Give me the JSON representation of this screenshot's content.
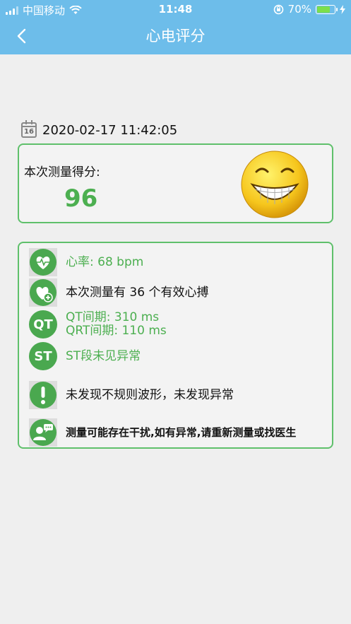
{
  "status_bar": {
    "carrier": "中国移动",
    "time": "11:48",
    "battery": "70%"
  },
  "nav": {
    "title": "心电评分"
  },
  "record": {
    "datetime": "2020-02-17 11:42:05",
    "calendar_day": "16"
  },
  "score": {
    "label": "本次测量得分:",
    "value": "96"
  },
  "details": {
    "heart_rate": "心率: 68 bpm",
    "beats": "本次测量有 36 个有效心搏",
    "qt_icon": "QT",
    "qt": "QT间期: 310 ms",
    "qrt": "QRT间期: 110 ms",
    "st_icon": "ST",
    "st": "ST段未见异常",
    "waveform": "未发现不规则波形，未发现异常",
    "advice": "测量可能存在干扰,如有异常,请重新测量或找医生"
  },
  "icons": {
    "back": "back-arrow-icon",
    "calendar": "calendar-icon",
    "smiley": "smiley-face-icon",
    "heart": "heart-rate-icon",
    "heart_plus": "heart-plus-icon",
    "alert": "exclamation-icon",
    "doctor": "doctor-chat-icon"
  },
  "colors": {
    "header": "#6dbdea",
    "accent_green": "#4caf50",
    "card_border": "#5fc06b"
  }
}
